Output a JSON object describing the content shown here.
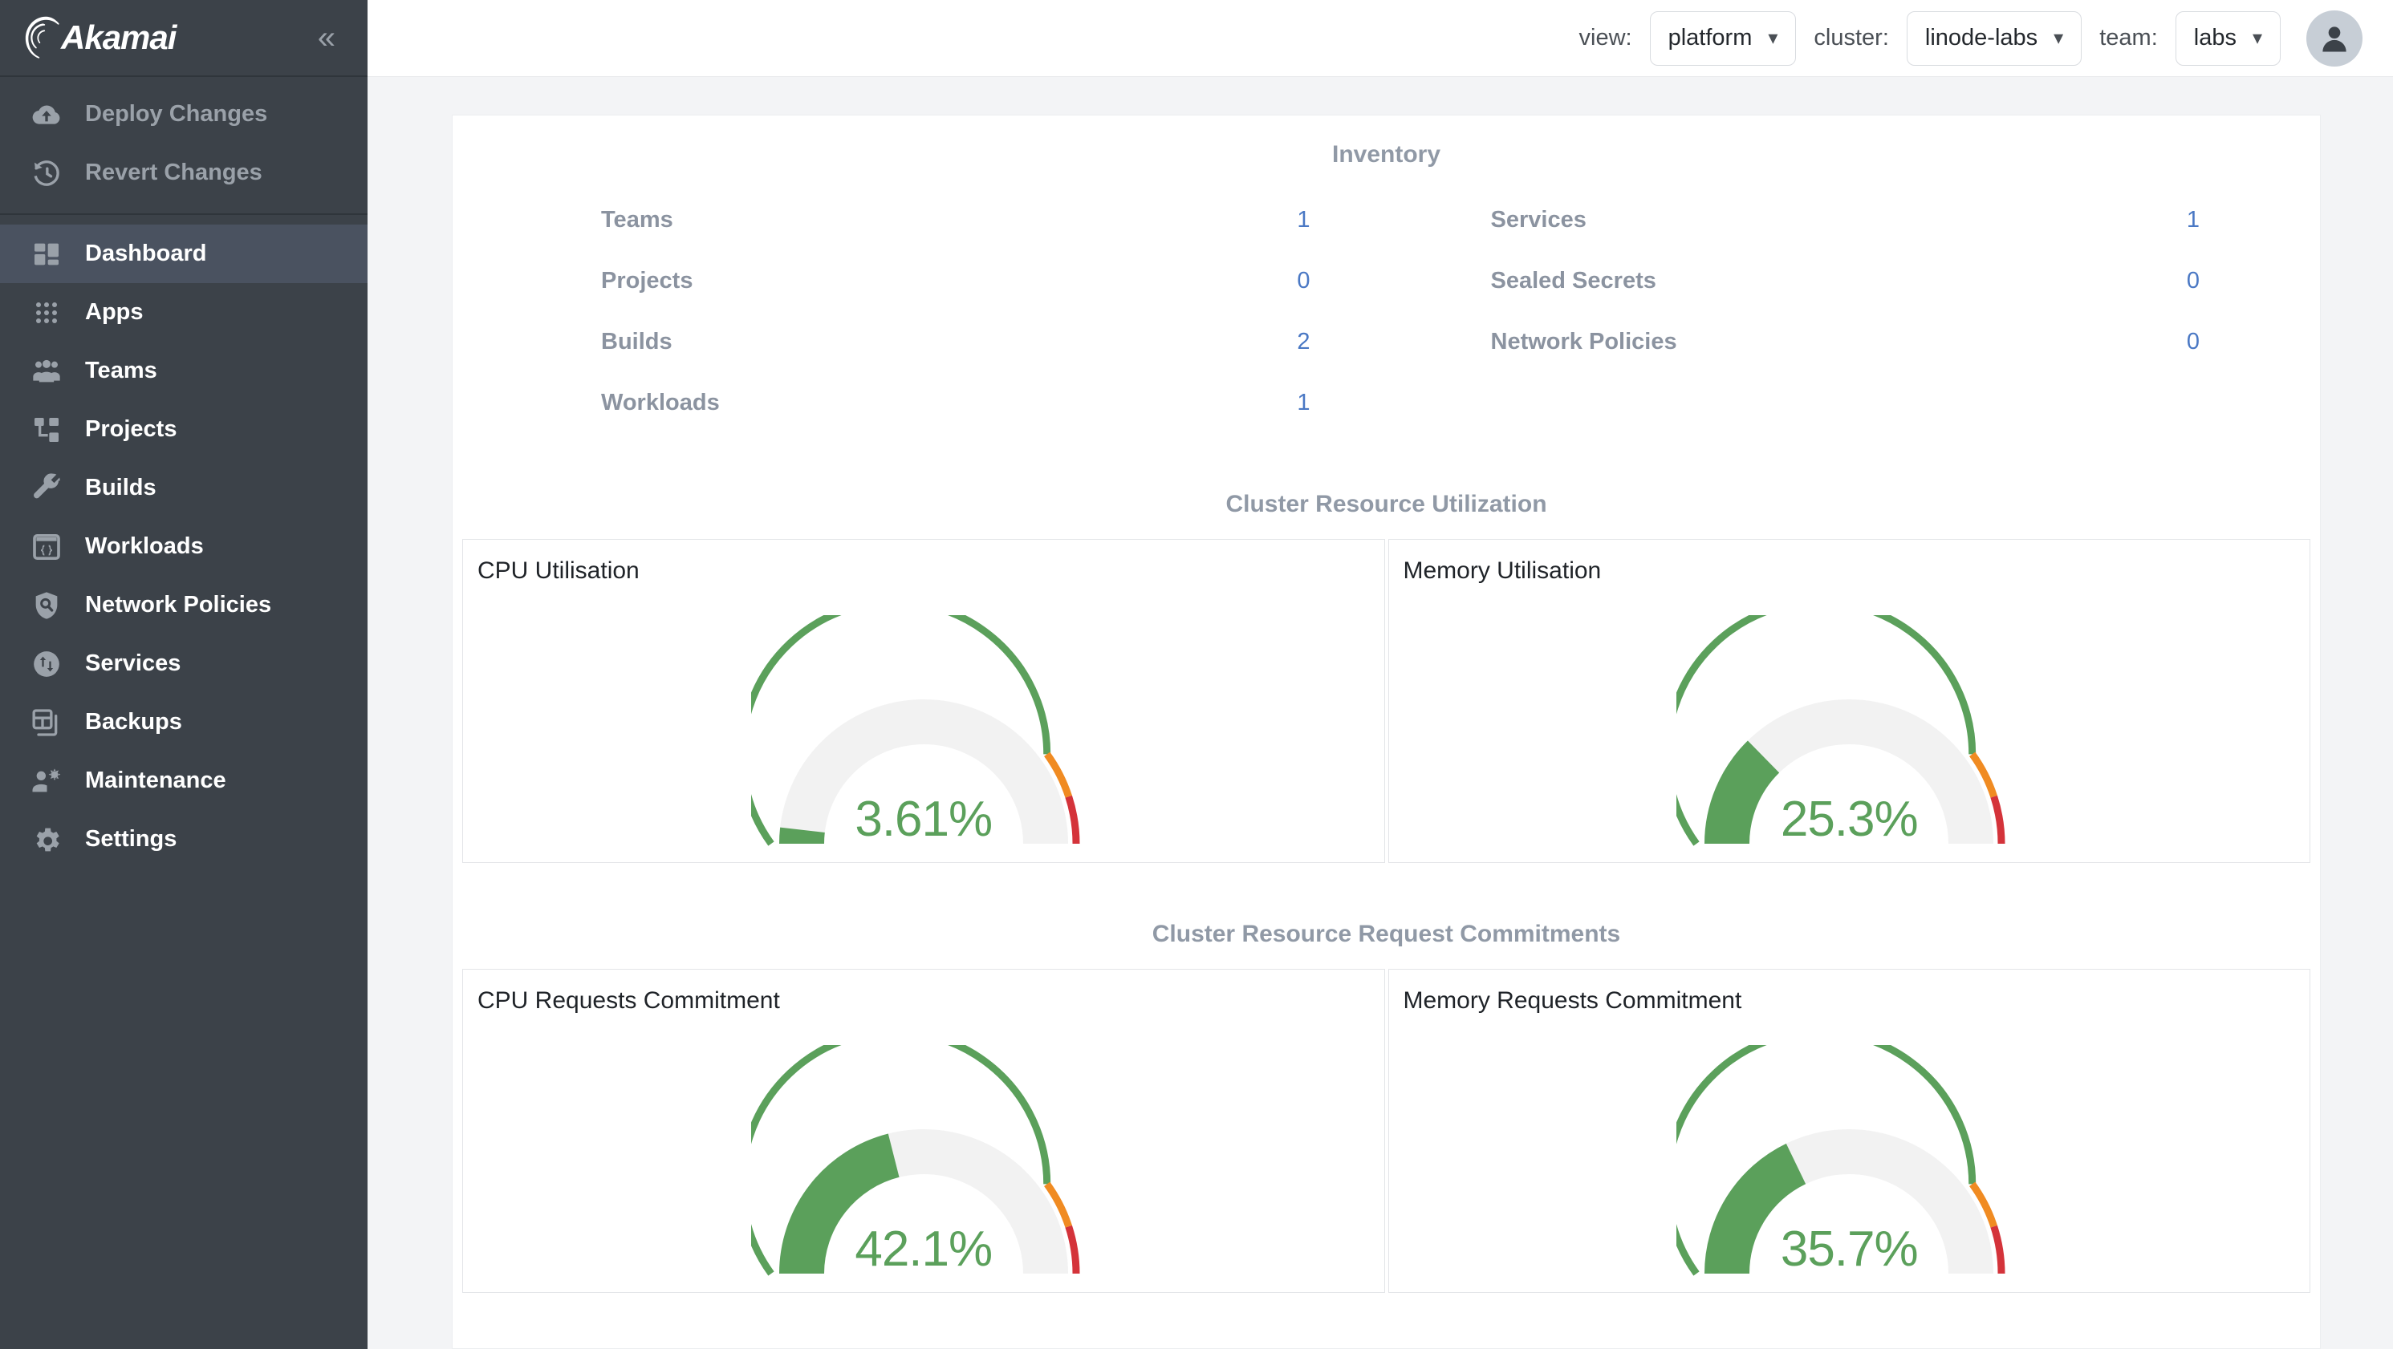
{
  "brand": {
    "name": "Akamai",
    "collapse_icon": "chevron-double-left-icon"
  },
  "sidebar": {
    "actions": [
      {
        "label": "Deploy Changes",
        "icon": "cloud-upload-icon"
      },
      {
        "label": "Revert Changes",
        "icon": "history-revert-icon"
      }
    ],
    "nav": [
      {
        "label": "Dashboard",
        "icon": "dashboard-grid-icon",
        "active": true
      },
      {
        "label": "Apps",
        "icon": "apps-dots-icon",
        "active": false
      },
      {
        "label": "Teams",
        "icon": "teams-people-icon",
        "active": false
      },
      {
        "label": "Projects",
        "icon": "projects-tree-icon",
        "active": false
      },
      {
        "label": "Builds",
        "icon": "wrench-icon",
        "active": false
      },
      {
        "label": "Workloads",
        "icon": "workloads-window-icon",
        "active": false
      },
      {
        "label": "Network Policies",
        "icon": "shield-search-icon",
        "active": false
      },
      {
        "label": "Services",
        "icon": "services-arrows-icon",
        "active": false
      },
      {
        "label": "Backups",
        "icon": "backups-layout-icon",
        "active": false
      },
      {
        "label": "Maintenance",
        "icon": "maintenance-user-gear-icon",
        "active": false
      },
      {
        "label": "Settings",
        "icon": "gear-icon",
        "active": false
      }
    ]
  },
  "topbar": {
    "view_label": "view:",
    "view_value": "platform",
    "cluster_label": "cluster:",
    "cluster_value": "linode-labs",
    "team_label": "team:",
    "team_value": "labs",
    "chevron": "⌄",
    "avatar_icon": "user-avatar-icon"
  },
  "inventory": {
    "title": "Inventory",
    "left": [
      {
        "name": "Teams",
        "value": "1"
      },
      {
        "name": "Projects",
        "value": "0"
      },
      {
        "name": "Builds",
        "value": "2"
      },
      {
        "name": "Workloads",
        "value": "1"
      }
    ],
    "right": [
      {
        "name": "Services",
        "value": "1"
      },
      {
        "name": "Sealed Secrets",
        "value": "0"
      },
      {
        "name": "Network Policies",
        "value": "0"
      }
    ]
  },
  "utilization": {
    "title": "Cluster Resource Utilization",
    "gauges": [
      {
        "title": "CPU Utilisation",
        "value_text": "3.61%"
      },
      {
        "title": "Memory Utilisation",
        "value_text": "25.3%"
      }
    ]
  },
  "commitments": {
    "title": "Cluster Resource Request Commitments",
    "gauges": [
      {
        "title": "CPU Requests Commitment",
        "value_text": "42.1%"
      },
      {
        "title": "Memory Requests Commitment",
        "value_text": "35.7%"
      }
    ]
  },
  "colors": {
    "sidebar_bg": "#3c4249",
    "sidebar_active": "#4a5260",
    "accent_link": "#4a78c4",
    "gauge_green": "#5ba05b",
    "gauge_orange": "#f08b22",
    "gauge_red": "#d4333a",
    "gauge_track": "#f2f2f2",
    "section_heading": "#9099a6"
  },
  "chart_data": [
    {
      "type": "gauge",
      "title": "CPU Utilisation",
      "value": 3.61,
      "unit": "%",
      "min": 0,
      "max": 100,
      "value_label": "3.61%",
      "thresholds": [
        {
          "from": 0,
          "to": 80,
          "color": "#5ba05b"
        },
        {
          "from": 80,
          "to": 90,
          "color": "#f08b22"
        },
        {
          "from": 90,
          "to": 100,
          "color": "#d4333a"
        }
      ]
    },
    {
      "type": "gauge",
      "title": "Memory Utilisation",
      "value": 25.3,
      "unit": "%",
      "min": 0,
      "max": 100,
      "value_label": "25.3%",
      "thresholds": [
        {
          "from": 0,
          "to": 80,
          "color": "#5ba05b"
        },
        {
          "from": 80,
          "to": 90,
          "color": "#f08b22"
        },
        {
          "from": 90,
          "to": 100,
          "color": "#d4333a"
        }
      ]
    },
    {
      "type": "gauge",
      "title": "CPU Requests Commitment",
      "value": 42.1,
      "unit": "%",
      "min": 0,
      "max": 100,
      "value_label": "42.1%",
      "thresholds": [
        {
          "from": 0,
          "to": 80,
          "color": "#5ba05b"
        },
        {
          "from": 80,
          "to": 90,
          "color": "#f08b22"
        },
        {
          "from": 90,
          "to": 100,
          "color": "#d4333a"
        }
      ]
    },
    {
      "type": "gauge",
      "title": "Memory Requests Commitment",
      "value": 35.7,
      "unit": "%",
      "min": 0,
      "max": 100,
      "value_label": "35.7%",
      "thresholds": [
        {
          "from": 0,
          "to": 80,
          "color": "#5ba05b"
        },
        {
          "from": 80,
          "to": 90,
          "color": "#f08b22"
        },
        {
          "from": 90,
          "to": 100,
          "color": "#d4333a"
        }
      ]
    }
  ]
}
